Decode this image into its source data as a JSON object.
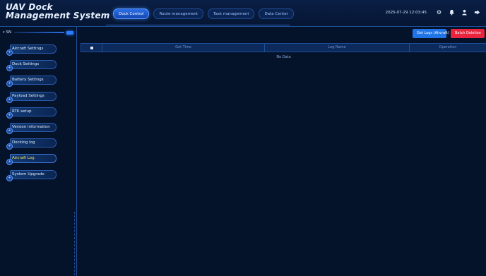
{
  "header": {
    "title": "UAV Dock Management System",
    "datetime": "2025-07-29 12:03:45",
    "icons": [
      "gear-icon",
      "bell-icon",
      "user-icon",
      "logout-icon"
    ]
  },
  "nav": {
    "tabs": [
      {
        "label": "Dock Control",
        "active": true
      },
      {
        "label": "Route management",
        "active": false
      },
      {
        "label": "Task management",
        "active": false
      },
      {
        "label": "Data Center",
        "active": false
      }
    ]
  },
  "sidebar": {
    "sn_label": "SN",
    "items": [
      {
        "label": "Aircraft Settings",
        "active": false
      },
      {
        "label": "Dock Settings",
        "active": false
      },
      {
        "label": "Battery Settings",
        "active": false
      },
      {
        "label": "Payload Settings",
        "active": false
      },
      {
        "label": "RTK setup",
        "active": false
      },
      {
        "label": "Version information",
        "active": false
      },
      {
        "label": "Docking log",
        "active": false
      },
      {
        "label": "Aircraft Log",
        "active": true
      },
      {
        "label": "System Upgrade",
        "active": false
      }
    ]
  },
  "main": {
    "get_logs_label": "Get Logs (Aircraft)",
    "batch_delete_label": "Batch Deletion",
    "columns": [
      "Get Time",
      "Log Name",
      "Operation"
    ],
    "empty_text": "No Data"
  },
  "colors": {
    "background": "#04122a",
    "accent": "#2b6fe6",
    "danger": "#e8243f",
    "active_text": "#ffe04a"
  }
}
